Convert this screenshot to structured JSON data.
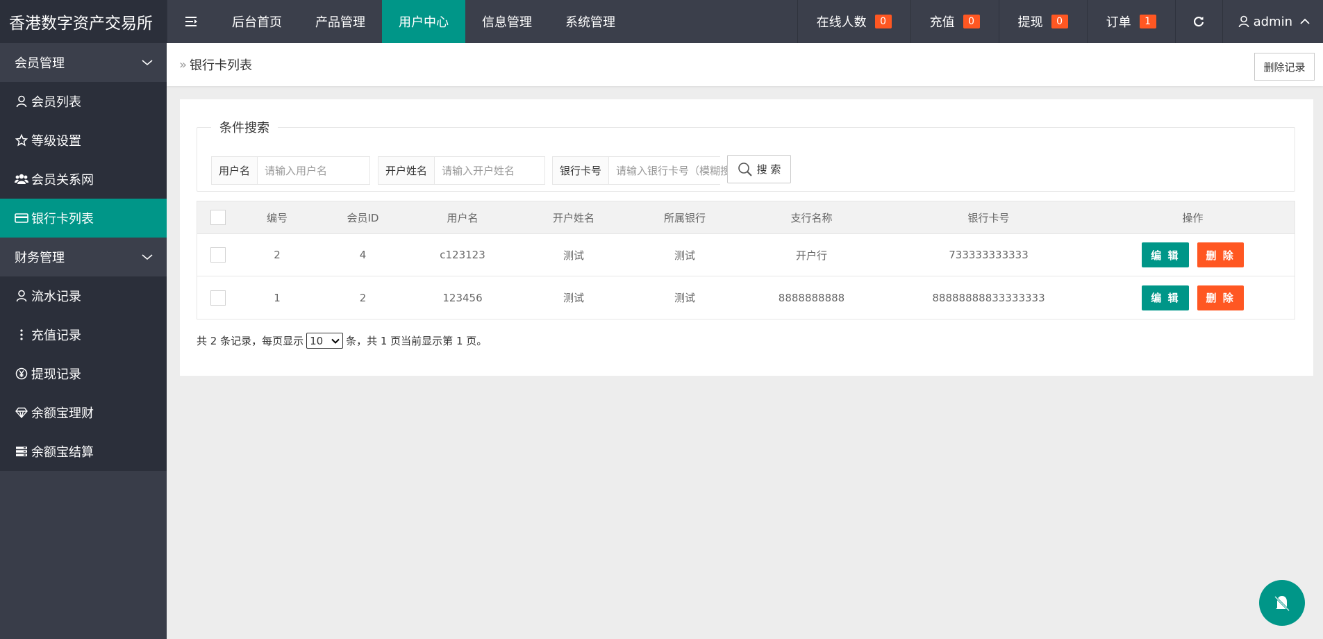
{
  "app": {
    "title": "香港数字资产交易所"
  },
  "topnav": {
    "items": [
      {
        "label": "后台首页"
      },
      {
        "label": "产品管理"
      },
      {
        "label": "用户中心"
      },
      {
        "label": "信息管理"
      },
      {
        "label": "系统管理"
      }
    ],
    "active_index": 2
  },
  "topright": {
    "online": {
      "label": "在线人数",
      "count": "0"
    },
    "recharge": {
      "label": "充值",
      "count": "0"
    },
    "withdraw": {
      "label": "提现",
      "count": "0"
    },
    "orders": {
      "label": "订单",
      "count": "1"
    },
    "user": "admin"
  },
  "sidebar": {
    "group1": "会员管理",
    "items1": [
      {
        "label": "会员列表",
        "icon": "user-icon"
      },
      {
        "label": "等级设置",
        "icon": "star-icon"
      },
      {
        "label": "会员关系网",
        "icon": "users-icon"
      },
      {
        "label": "银行卡列表",
        "icon": "card-icon"
      }
    ],
    "group2": "财务管理",
    "items2": [
      {
        "label": "流水记录",
        "icon": "user-icon"
      },
      {
        "label": "充值记录",
        "icon": "vertical-dots-icon"
      },
      {
        "label": "提现记录",
        "icon": "yen-icon"
      },
      {
        "label": "余额宝理财",
        "icon": "diamond-icon"
      },
      {
        "label": "余额宝结算",
        "icon": "server-icon"
      }
    ]
  },
  "breadcrumb": {
    "title": "银行卡列表",
    "delete_button": "删除记录"
  },
  "search": {
    "legend": "条件搜索",
    "username": {
      "label": "用户名",
      "placeholder": "请输入用户名"
    },
    "account_name": {
      "label": "开户姓名",
      "placeholder": "请输入开户姓名"
    },
    "card_no": {
      "label": "银行卡号",
      "placeholder": "请输入银行卡号（模糊搜索）"
    },
    "button": "搜 索"
  },
  "table": {
    "headers": [
      "编号",
      "会员ID",
      "用户名",
      "开户姓名",
      "所属银行",
      "支行名称",
      "银行卡号",
      "操作"
    ],
    "rows": [
      {
        "id": "2",
        "member_id": "4",
        "username": "c123123",
        "name": "测试",
        "bank": "测试",
        "branch": "开户行",
        "card": "733333333333"
      },
      {
        "id": "1",
        "member_id": "2",
        "username": "123456",
        "name": "测试",
        "bank": "测试",
        "branch": "8888888888",
        "card": "88888888833333333"
      }
    ],
    "edit_label": "编 辑",
    "delete_label": "删 除"
  },
  "pager": {
    "prefix": "共 2 条记录，每页显示",
    "page_size": "10",
    "suffix": "条，共 1 页当前显示第 1 页。"
  },
  "colors": {
    "accent": "#009688",
    "danger": "#ff5722",
    "header": "#3b3f4b"
  }
}
